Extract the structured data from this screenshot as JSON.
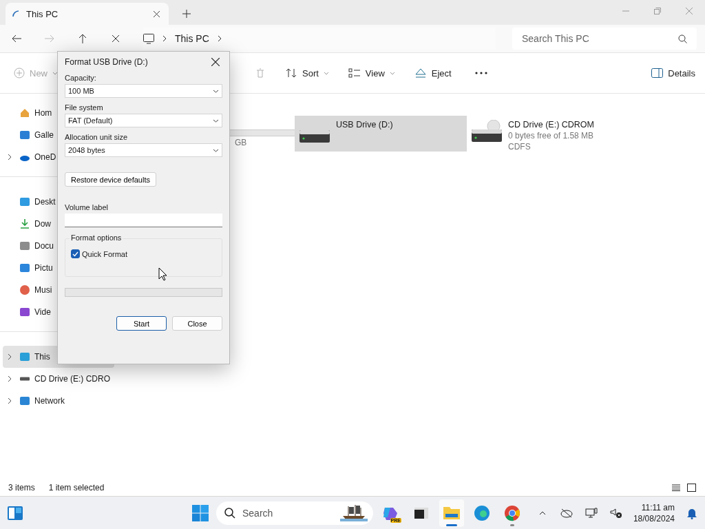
{
  "tabs": [
    {
      "title": "This PC",
      "selected": true
    }
  ],
  "address": {
    "path": [
      "This PC"
    ]
  },
  "search": {
    "placeholder": "Search This PC"
  },
  "commands": [
    {
      "kind": "new",
      "label": "New",
      "disabled": true
    },
    {
      "kind": "delete",
      "disabled": true
    },
    {
      "kind": "sort",
      "label": "Sort",
      "disabled": false
    },
    {
      "kind": "view",
      "label": "View",
      "disabled": false
    },
    {
      "kind": "eject",
      "label": "Eject",
      "disabled": false
    },
    {
      "kind": "more",
      "disabled": false
    }
  ],
  "details_button": {
    "label": "Details"
  },
  "sidebar": {
    "groups": [
      [
        {
          "kind": "home",
          "label": "Hom",
          "expandable": false,
          "selected": false
        },
        {
          "kind": "gallery",
          "label": "Galle",
          "expandable": false,
          "selected": false
        },
        {
          "kind": "cloud",
          "label": "OneD",
          "expandable": true,
          "selected": false
        }
      ],
      [
        {
          "kind": "desktop",
          "label": "Deskt",
          "expandable": false,
          "selected": false
        },
        {
          "kind": "download",
          "label": "Dow",
          "expandable": false,
          "selected": false
        },
        {
          "kind": "document",
          "label": "Docu",
          "expandable": false,
          "selected": false
        },
        {
          "kind": "pictures",
          "label": "Pictu",
          "expandable": false,
          "selected": false
        },
        {
          "kind": "music",
          "label": "Musi",
          "expandable": false,
          "selected": false
        },
        {
          "kind": "video",
          "label": "Vide",
          "expandable": false,
          "selected": false
        }
      ],
      [
        {
          "kind": "pc",
          "label": "This",
          "expandable": true,
          "selected": true
        },
        {
          "kind": "cd",
          "label": "CD Drive (E:) CDRO",
          "expandable": true,
          "selected": false
        },
        {
          "kind": "network",
          "label": "Network",
          "expandable": true,
          "selected": false
        }
      ]
    ]
  },
  "drives": [
    {
      "kind": "partial",
      "detail": "GB",
      "selected": false
    },
    {
      "kind": "usb",
      "name": "USB Drive (D:)",
      "selected": true
    },
    {
      "kind": "cd",
      "name": "CD Drive (E:) CDROM",
      "detail": "0 bytes free of 1.58 MB",
      "filesystem": "CDFS",
      "selected": false
    }
  ],
  "status_bar": {
    "count": "3 items",
    "selection": "1 item selected"
  },
  "dialog": {
    "title": "Format USB Drive (D:)",
    "fields": [
      {
        "label": "Capacity:",
        "value": "100 MB"
      },
      {
        "label": "File system",
        "value": "FAT (Default)"
      },
      {
        "label": "Allocation unit size",
        "value": "2048 bytes"
      }
    ],
    "restore_button": "Restore device defaults",
    "volume_label": {
      "label": "Volume label"
    },
    "options": {
      "title": "Format options",
      "quick_format": {
        "label": "Quick Format",
        "checked": true
      }
    },
    "progress": {
      "level": 0
    },
    "buttons": [
      {
        "label": "Start",
        "default": true
      },
      {
        "label": "Close",
        "default": false
      }
    ]
  },
  "taskbar": {
    "search": {
      "placeholder": "Search"
    },
    "apps": [
      {
        "kind": "copilot",
        "badge": "PRE",
        "active": false,
        "running": false
      },
      {
        "kind": "terminal",
        "active": false,
        "running": false
      },
      {
        "kind": "explorer",
        "active": true,
        "running": true
      },
      {
        "kind": "edge",
        "active": false,
        "running": false
      },
      {
        "kind": "chrome",
        "active": false,
        "running": true
      }
    ],
    "clock": {
      "time": "11:11 am",
      "date": "18/08/2024"
    }
  }
}
